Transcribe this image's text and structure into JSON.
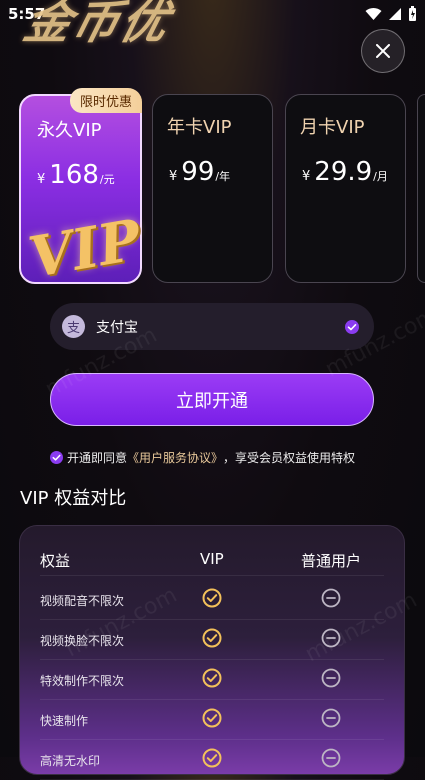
{
  "status_bar": {
    "time": "5:57"
  },
  "hero": {
    "lettering": "金币优"
  },
  "plans": [
    {
      "name": "永久VIP",
      "currency": "¥",
      "price": "168",
      "unit": "/元",
      "badge": "限时优惠",
      "selected": true
    },
    {
      "name": "年卡VIP",
      "currency": "¥",
      "price": "99",
      "unit": "/年",
      "selected": false
    },
    {
      "name": "月卡VIP",
      "currency": "¥",
      "price": "29.9",
      "unit": "/月",
      "selected": false
    }
  ],
  "vip_art_text": "VIP",
  "payment": {
    "method": "支付宝",
    "icon_glyph": "支",
    "selected": true
  },
  "cta_label": "立即开通",
  "agreement": {
    "prefix": "开通即同意",
    "link": "《用户服务协议》",
    "suffix": "，享受会员权益使用特权"
  },
  "benefits": {
    "title": "VIP 权益对比",
    "headers": [
      "权益",
      "VIP",
      "普通用户"
    ],
    "rows": [
      {
        "label": "视频配音不限次",
        "vip": "check-icon",
        "normal": "minus-circle-icon"
      },
      {
        "label": "视频换脸不限次",
        "vip": "check-icon",
        "normal": "minus-circle-icon"
      },
      {
        "label": "特效制作不限次",
        "vip": "check-icon",
        "normal": "minus-circle-icon"
      },
      {
        "label": "快速制作",
        "vip": "check-icon",
        "normal": "minus-circle-icon"
      },
      {
        "label": "高清无水印",
        "vip": "check-icon",
        "normal": "minus-circle-icon"
      }
    ]
  },
  "watermark": "mfunz.com",
  "colors": {
    "accent_purple": "#8b2ee3",
    "gold": "#f0c266",
    "background": "#0f0b10",
    "check_icon": "#f3c15a"
  }
}
